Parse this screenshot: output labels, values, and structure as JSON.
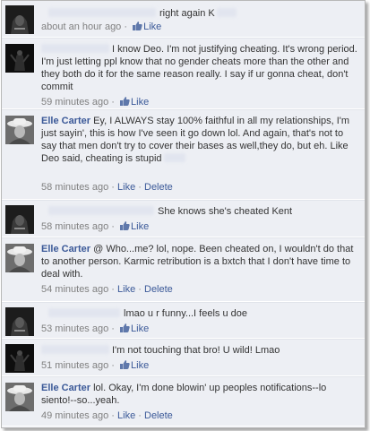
{
  "comments": [
    {
      "author": "",
      "text": "right again K",
      "time": "about an hour ago",
      "actions": [
        "Like"
      ],
      "avatar": "hooded-figure"
    },
    {
      "author": "",
      "text": "I know Deo. I'm not justifying cheating. It's wrong period. I'm just letting ppl know that no gender cheats more than the other and they both do it for the same reason really. I say if ur gonna cheat, don't commit",
      "time": "59 minutes ago",
      "actions": [
        "Like"
      ],
      "avatar": "dark-figure"
    },
    {
      "author": "Elle Carter",
      "text": "Ey, I ALWAYS stay 100% faithful in all my relationships, I'm just sayin', this is how I've seen it go down lol. And again, that's not to say that men don't try to cover their bases as well,they do, but eh. Like Deo said, cheating is stupid",
      "time": "58 minutes ago",
      "actions": [
        "Like",
        "Delete"
      ],
      "avatar": "hat-woman"
    },
    {
      "author": "",
      "text": "She knows she's cheated Kent",
      "time": "58 minutes ago",
      "actions": [
        "Like"
      ],
      "avatar": "hooded-figure"
    },
    {
      "author": "Elle Carter",
      "text": "@ Who...me? lol, nope. Been cheated on, I wouldn't do that to another person. Karmic retribution is a bxtch that I don't have time to deal with.",
      "time": "54 minutes ago",
      "actions": [
        "Like",
        "Delete"
      ],
      "avatar": "hat-woman"
    },
    {
      "author": "",
      "text": "lmao u r funny...I feels u doe",
      "time": "53 minutes ago",
      "actions": [
        "Like"
      ],
      "avatar": "hooded-figure"
    },
    {
      "author": "",
      "text": "I'm not touching that bro! U wild! Lmao",
      "time": "51 minutes ago",
      "actions": [
        "Like"
      ],
      "avatar": "dark-figure"
    },
    {
      "author": "Elle Carter",
      "text": "lol. Okay, I'm done blowin' up peoples notifications--lo siento!--so...yeah.",
      "time": "49 minutes ago",
      "actions": [
        "Like",
        "Delete"
      ],
      "avatar": "hat-woman"
    }
  ],
  "colors": {
    "link": "#3b5998",
    "meta": "#808080",
    "background": "#edeff4",
    "text": "#333333"
  }
}
